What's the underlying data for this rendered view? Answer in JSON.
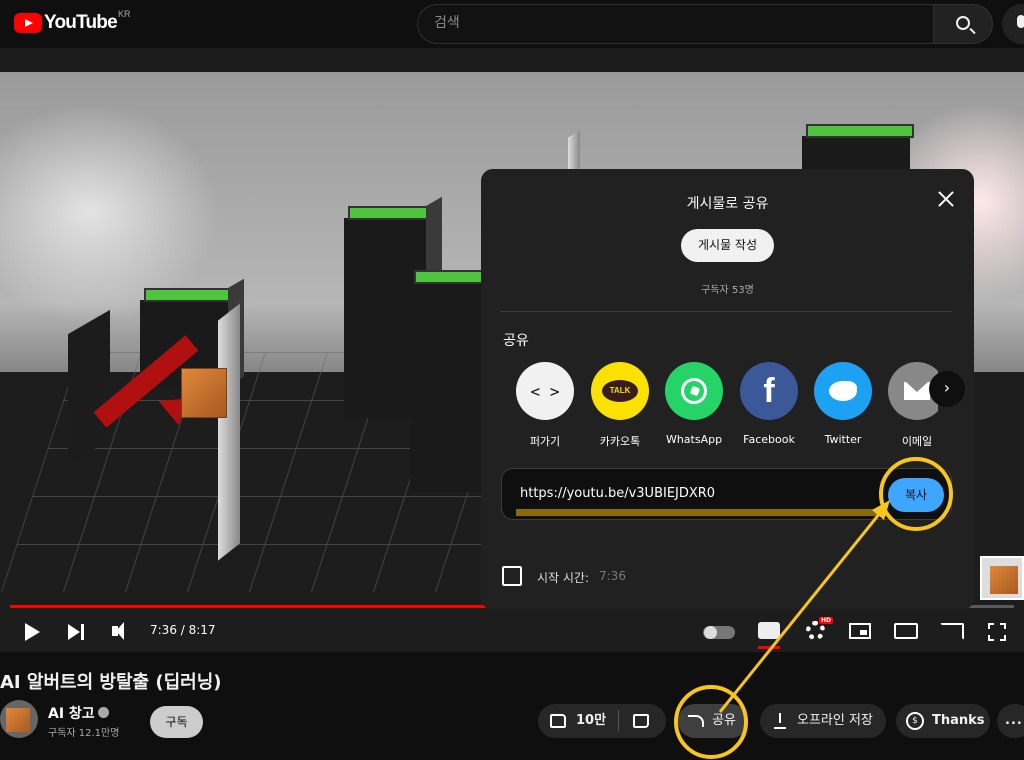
{
  "masthead": {
    "logo_text": "YouTube",
    "country_code": "KR",
    "search_placeholder": "검색"
  },
  "player": {
    "current_time": "7:36",
    "duration": "8:17",
    "time_display": "7:36 / 8:17",
    "progress_fraction": 0.9155,
    "hd_badge": "HD"
  },
  "share_dialog": {
    "title": "게시물로 공유",
    "create_post_label": "게시물 작성",
    "subscriber_count": "구독자 53명",
    "share_label": "공유",
    "targets": [
      {
        "label": "퍼가기",
        "icon": "embed-icon"
      },
      {
        "label": "카카오톡",
        "icon": "kakaotalk-icon",
        "icon_text": "TALK"
      },
      {
        "label": "WhatsApp",
        "icon": "whatsapp-icon"
      },
      {
        "label": "Facebook",
        "icon": "facebook-icon",
        "icon_text": "f"
      },
      {
        "label": "Twitter",
        "icon": "twitter-icon"
      },
      {
        "label": "이메일",
        "icon": "email-icon"
      }
    ],
    "url": "https://youtu.be/v3UBIEJDXR0",
    "copy_label": "복사",
    "start_at_label": "시작 시간:",
    "start_at_value": "7:36",
    "start_at_checked": false
  },
  "video": {
    "title": "AI 알버트의 방탈출 (딥러닝)",
    "channel_name": "AI 창고",
    "channel_subscribers": "구독자 12.1만명",
    "subscribe_label": "구독",
    "like_count": "10만",
    "share_label": "공유",
    "download_label": "오프라인 저장",
    "thanks_label": "Thanks",
    "more_label": "..."
  },
  "colors": {
    "youtube_red": "#ff0000",
    "highlight_ring": "#f7c520",
    "copy_button": "#3ea6ff"
  }
}
